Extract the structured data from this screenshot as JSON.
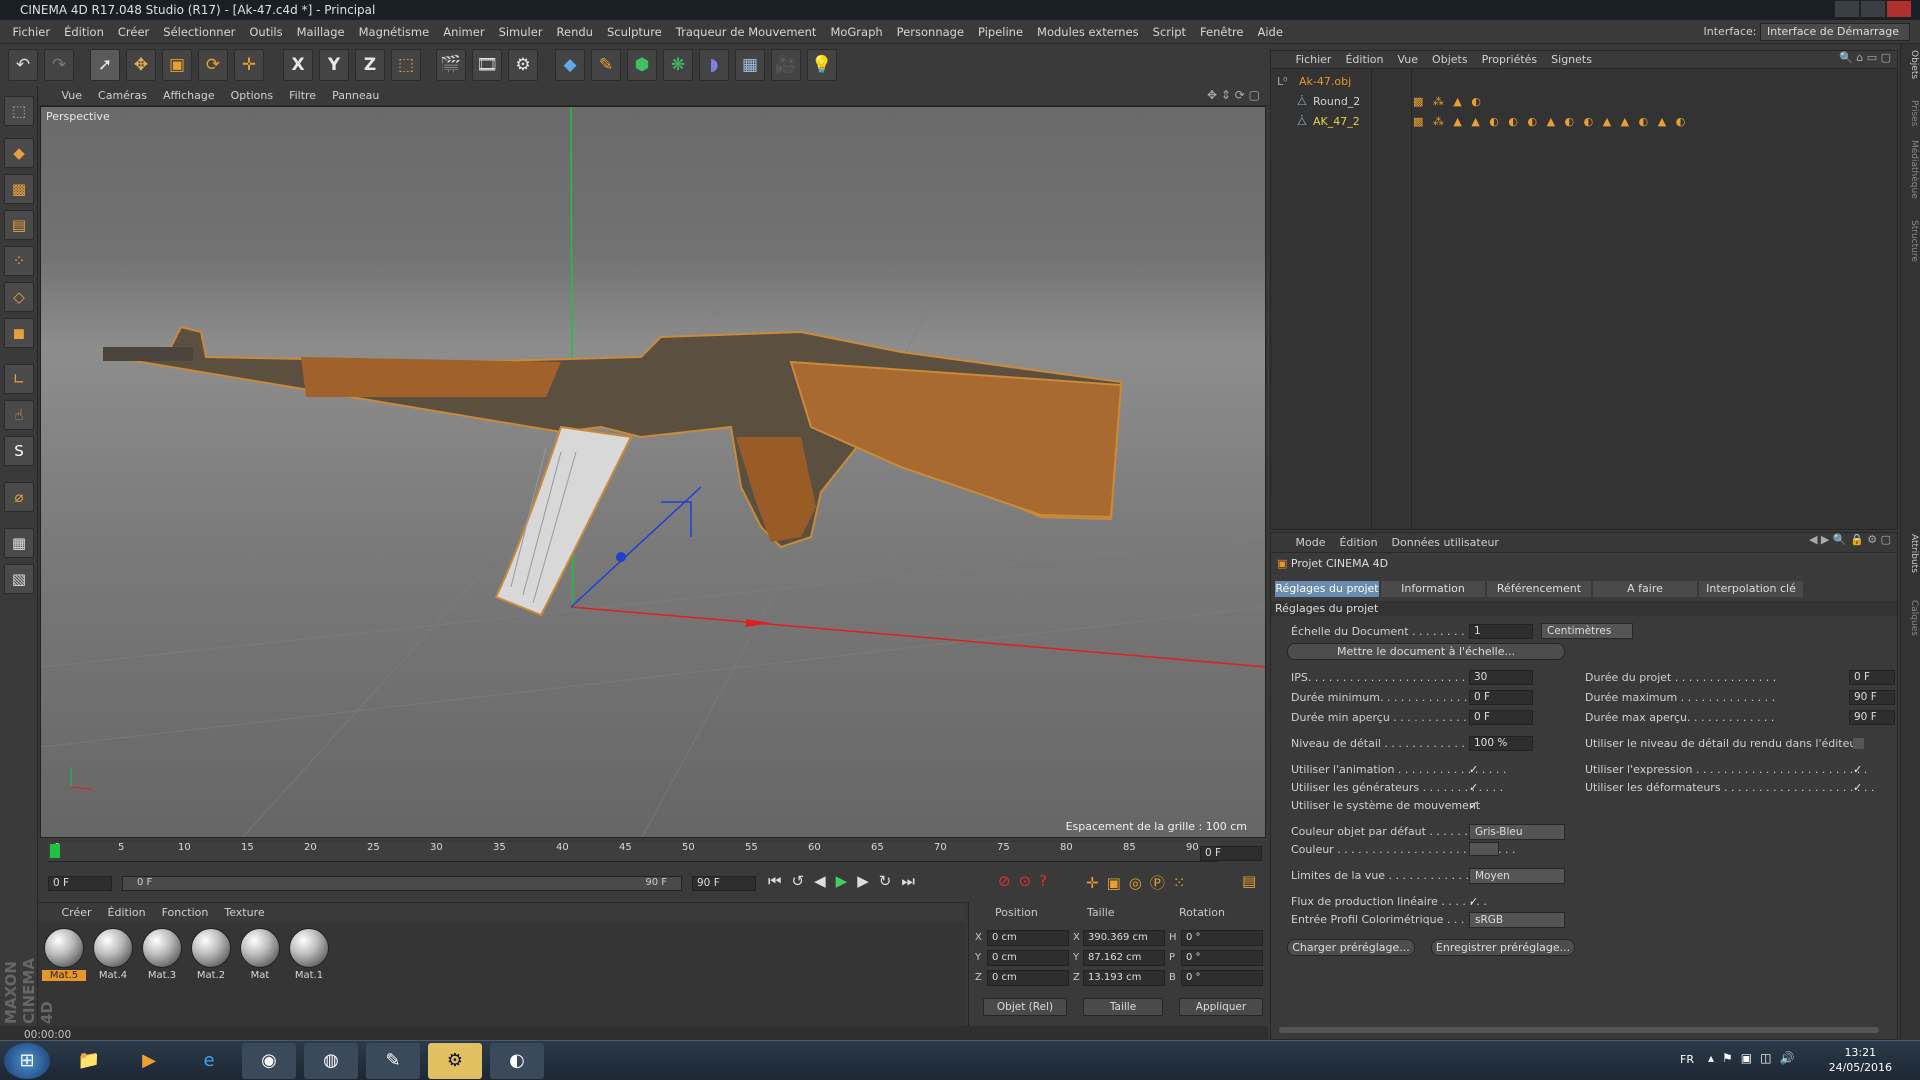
{
  "window": {
    "title": "CINEMA 4D R17.048 Studio (R17) - [Ak-47.c4d *] - Principal"
  },
  "menubar": {
    "items": [
      "Fichier",
      "Édition",
      "Créer",
      "Sélectionner",
      "Outils",
      "Maillage",
      "Magnétisme",
      "Animer",
      "Simuler",
      "Rendu",
      "Sculpture",
      "Traqueur de Mouvement",
      "MoGraph",
      "Personnage",
      "Pipeline",
      "Modules externes",
      "Script",
      "Fenêtre",
      "Aide"
    ],
    "interface_label": "Interface:",
    "interface_value": "Interface de Démarrage"
  },
  "toolbar": {
    "icons": [
      "undo-icon",
      "redo-icon",
      "select-arrow-icon",
      "move-icon",
      "scale-icon",
      "rotate-icon",
      "transform-icon",
      "axis-x-icon",
      "axis-y-icon",
      "axis-z-icon",
      "coordinate-system-icon",
      "render-view-icon",
      "render-picture-viewer-icon",
      "render-settings-icon",
      "cube-icon",
      "pen-spline-icon",
      "subdivision-icon",
      "cloner-icon",
      "deformer-icon",
      "floor-icon",
      "camera-icon",
      "light-icon"
    ],
    "axis_labels": [
      "X",
      "Y",
      "Z"
    ]
  },
  "lefttools": {
    "icons": [
      "scene-icon",
      "model-mode-icon",
      "texture-mode-icon",
      "workplane-icon",
      "points-mode-icon",
      "edges-mode-icon",
      "polygons-mode-icon",
      "uv-icon",
      "tweak-icon",
      "snap-icon",
      "magnet-icon",
      "grid-lock-icon",
      "quantize-icon"
    ]
  },
  "viewport": {
    "menu": [
      "Vue",
      "Caméras",
      "Affichage",
      "Options",
      "Filtre",
      "Panneau"
    ],
    "label": "Perspective",
    "grid_spacing": "Espacement de la grille : 100 cm"
  },
  "timeline": {
    "ticks": [
      "0",
      "5",
      "10",
      "15",
      "20",
      "25",
      "30",
      "35",
      "40",
      "45",
      "50",
      "55",
      "60",
      "65",
      "70",
      "75",
      "80",
      "85",
      "90"
    ],
    "current_frame": "0 F",
    "start_field": "0 F",
    "range_start": "0 F",
    "range_end": "90 F",
    "end_field": "90 F"
  },
  "materials": {
    "menu": [
      "Créer",
      "Édition",
      "Fonction",
      "Texture"
    ],
    "items": [
      {
        "name": "Mat.5",
        "selected": true
      },
      {
        "name": "Mat.4",
        "selected": false
      },
      {
        "name": "Mat.3",
        "selected": false
      },
      {
        "name": "Mat.2",
        "selected": false
      },
      {
        "name": "Mat",
        "selected": false
      },
      {
        "name": "Mat.1",
        "selected": false
      }
    ],
    "brand": "MAXON CINEMA 4D"
  },
  "coords": {
    "headers": [
      "Position",
      "Taille",
      "Rotation"
    ],
    "rows": [
      {
        "axis": "X",
        "pos": "0 cm",
        "size_axis": "X",
        "size": "390.369 cm",
        "rot_axis": "H",
        "rot": "0 °"
      },
      {
        "axis": "Y",
        "pos": "0 cm",
        "size_axis": "Y",
        "size": "87.162 cm",
        "rot_axis": "P",
        "rot": "0 °"
      },
      {
        "axis": "Z",
        "pos": "0 cm",
        "size_axis": "Z",
        "size": "13.193 cm",
        "rot_axis": "B",
        "rot": "0 °"
      }
    ],
    "mode1": "Objet (Rel)",
    "mode2": "Taille",
    "apply": "Appliquer"
  },
  "status": {
    "time": "00:00:00"
  },
  "objects": {
    "menu": [
      "Fichier",
      "Édition",
      "Vue",
      "Objets",
      "Propriétés",
      "Signets"
    ],
    "rows": [
      {
        "name": "Ak-47.obj",
        "color": "#e89628"
      },
      {
        "name": "Round_2",
        "color": "#d0d0d0"
      },
      {
        "name": "AK_47_2",
        "color": "#e8d040"
      }
    ]
  },
  "attributes": {
    "menu": [
      "Mode",
      "Édition",
      "Données utilisateur"
    ],
    "header": "Projet CINEMA 4D",
    "tabs": [
      "Réglages du projet",
      "Information",
      "Référencement",
      "A faire",
      "Interpolation clé"
    ],
    "section": "Réglages du projet",
    "doc_scale_label": "Échelle du Document . . . . . . . . . . . . .",
    "doc_scale_value": "1",
    "doc_scale_unit": "Centimètres",
    "scale_button": "Mettre le document à l'échelle...",
    "fps_label": "IPS. . . . . . . . . . . . . . . . . . . . . . . . . . . . . .",
    "fps_value": "30",
    "project_duration_label": "Durée du projet . . . . . . . . . . . . . . . . . . . . . . . . . . . . . . . . . . .",
    "project_duration_value": "0 F",
    "min_duration_label": "Durée minimum. . . . . . . . . . . . . . . . . .",
    "min_duration_value": "0 F",
    "max_duration_label": "Durée maximum . . . . . . . . . . . . . . . . . . . . . . . . . . . . . . . . . . .",
    "max_duration_value": "90 F",
    "min_preview_label": "Durée min aperçu . . . . . . . . . . . . . . . .",
    "min_preview_value": "0 F",
    "max_preview_label": "Durée max aperçu. . . . . . . . . . . . . . . . . . . . . . . . . . . . . . . . . .",
    "max_preview_value": "90 F",
    "lod_label": "Niveau de détail . . . . . . . . . . . . . . . .",
    "lod_value": "100 %",
    "render_lod_label": "Utiliser le niveau de détail du rendu dans l'éditeur",
    "use_anim_label": "Utiliser l'animation . . . . . . . . . . . . . . . .",
    "use_expr_label": "Utiliser l'expression . . . . . . . . . . . . . . . . . . . . . . . . .",
    "use_gen_label": "Utiliser les générateurs . . . . . . . . . . . .",
    "use_def_label": "Utiliser les déformateurs . . . . . . . . . . . . . . . . . . . . . .",
    "use_motion_label": "Utiliser le système de mouvement",
    "default_color_label": "Couleur objet par défaut . . . . . . . .",
    "default_color_value": "Gris-Bleu",
    "color_label": "Couleur . . . . . . . . . . . . . . . . . . . . . . . . . .",
    "view_clip_label": "Limites de la vue . . . . . . . . . . . . . . . . .",
    "view_clip_value": "Moyen",
    "linear_flow_label": "Flux de production linéaire . . . . . . .",
    "color_profile_label": "Entrée Profil Colorimétrique . . . . . .",
    "color_profile_value": "sRGB",
    "load_preset": "Charger préréglage...",
    "save_preset": "Enregistrer préréglage..."
  },
  "right_tabs": [
    "Objets",
    "Prises",
    "Médiathèque",
    "Structure",
    "Attributs",
    "Calques"
  ],
  "taskbar": {
    "apps": [
      "start-icon",
      "explorer-icon",
      "media-player-icon",
      "internet-explorer-icon",
      "chrome-icon",
      "cinema4d-icon",
      "notepad-icon",
      "steam-icon",
      "teamspeak-icon"
    ],
    "language": "FR",
    "time": "13:21",
    "date": "24/05/2016"
  },
  "colors": {
    "accent": "#e89628",
    "tab_active": "#6a8bb0",
    "axis_x": "#e02020",
    "axis_y": "#20c040",
    "axis_z": "#2040d0"
  }
}
